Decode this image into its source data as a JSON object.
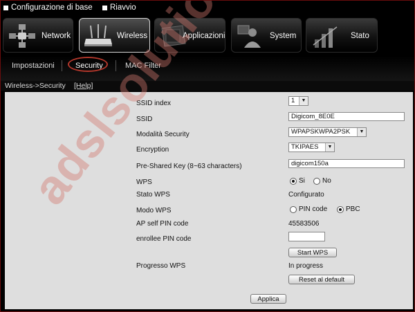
{
  "topbar": {
    "config_label": "Configurazione di base",
    "reboot_label": "Riavvio"
  },
  "nav": {
    "network": "Network",
    "wireless": "Wireless",
    "applicazioni": "Applicazioni",
    "system": "System",
    "stato": "Stato"
  },
  "subnav": {
    "impostazioni": "Impostazioni",
    "security": "Security",
    "mac_filter": "MAC Filter"
  },
  "breadcrumb": {
    "path": "Wireless->Security",
    "help": "[Help]"
  },
  "form": {
    "ssid_index": {
      "label": "SSID index",
      "value": "1"
    },
    "ssid": {
      "label": "SSID",
      "value": "Digicom_8E0E"
    },
    "modalita": {
      "label": "Modalità Security",
      "value": "WPAPSKWPA2PSK"
    },
    "encryption": {
      "label": "Encryption",
      "value": "TKIPAES"
    },
    "psk": {
      "label": "Pre-Shared Key (8~63 characters)",
      "value": "digicom150a"
    },
    "wps": {
      "label": "WPS",
      "opt_si": "Si",
      "opt_no": "No",
      "selected": "Si"
    },
    "stato_wps": {
      "label": "Stato WPS",
      "value": "Configurato"
    },
    "modo_wps": {
      "label": "Modo WPS",
      "opt_pin": "PIN code",
      "opt_pbc": "PBC",
      "selected": "PBC"
    },
    "ap_pin": {
      "label": "AP self PIN code",
      "value": "45583506"
    },
    "enrollee_pin": {
      "label": "enrollee PIN code",
      "value": ""
    },
    "start_wps": "Start WPS",
    "progresso": {
      "label": "Progresso WPS",
      "value": "In progress"
    },
    "reset": "Reset al default",
    "applica": "Applica"
  },
  "watermark": "adslsolution",
  "colors": {
    "highlight_circle": "#b3372b",
    "watermark": "#d2786e",
    "panel": "#dedede"
  }
}
